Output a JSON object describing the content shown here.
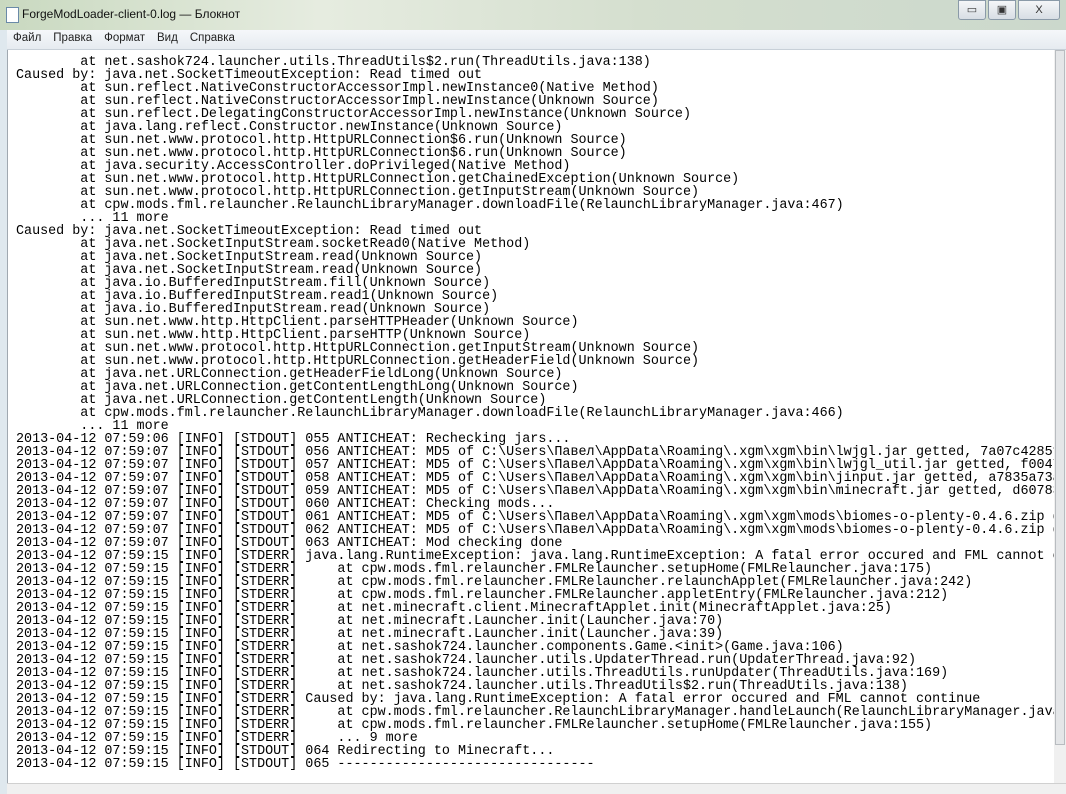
{
  "window": {
    "title": "ForgeModLoader-client-0.log — Блокнот",
    "minimize": "▭",
    "maximize": "▣",
    "close": "X"
  },
  "menu": [
    "Файл",
    "Правка",
    "Формат",
    "Вид",
    "Справка"
  ],
  "lines": [
    "        at net.sashok724.launcher.utils.ThreadUtils$2.run(ThreadUtils.java:138)",
    "Caused by: java.net.SocketTimeoutException: Read timed out",
    "        at sun.reflect.NativeConstructorAccessorImpl.newInstance0(Native Method)",
    "        at sun.reflect.NativeConstructorAccessorImpl.newInstance(Unknown Source)",
    "        at sun.reflect.DelegatingConstructorAccessorImpl.newInstance(Unknown Source)",
    "        at java.lang.reflect.Constructor.newInstance(Unknown Source)",
    "        at sun.net.www.protocol.http.HttpURLConnection$6.run(Unknown Source)",
    "        at sun.net.www.protocol.http.HttpURLConnection$6.run(Unknown Source)",
    "        at java.security.AccessController.doPrivileged(Native Method)",
    "        at sun.net.www.protocol.http.HttpURLConnection.getChainedException(Unknown Source)",
    "        at sun.net.www.protocol.http.HttpURLConnection.getInputStream(Unknown Source)",
    "        at cpw.mods.fml.relauncher.RelaunchLibraryManager.downloadFile(RelaunchLibraryManager.java:467)",
    "        ... 11 more",
    "Caused by: java.net.SocketTimeoutException: Read timed out",
    "        at java.net.SocketInputStream.socketRead0(Native Method)",
    "        at java.net.SocketInputStream.read(Unknown Source)",
    "        at java.net.SocketInputStream.read(Unknown Source)",
    "        at java.io.BufferedInputStream.fill(Unknown Source)",
    "        at java.io.BufferedInputStream.read1(Unknown Source)",
    "        at java.io.BufferedInputStream.read(Unknown Source)",
    "        at sun.net.www.http.HttpClient.parseHTTPHeader(Unknown Source)",
    "        at sun.net.www.http.HttpClient.parseHTTP(Unknown Source)",
    "        at sun.net.www.protocol.http.HttpURLConnection.getInputStream(Unknown Source)",
    "        at sun.net.www.protocol.http.HttpURLConnection.getHeaderField(Unknown Source)",
    "        at java.net.URLConnection.getHeaderFieldLong(Unknown Source)",
    "        at java.net.URLConnection.getContentLengthLong(Unknown Source)",
    "        at java.net.URLConnection.getContentLength(Unknown Source)",
    "        at cpw.mods.fml.relauncher.RelaunchLibraryManager.downloadFile(RelaunchLibraryManager.java:466)",
    "        ... 11 more",
    "2013-04-12 07:59:06 [INFO] [STDOUT] 055 ANTICHEAT: Rechecking jars...",
    "2013-04-12 07:59:07 [INFO] [STDOUT] 056 ANTICHEAT: MD5 of C:\\Users\\Павел\\AppData\\Roaming\\.xgm\\xgm\\bin\\lwjgl.jar getted, 7a07c4285f",
    "2013-04-12 07:59:07 [INFO] [STDOUT] 057 ANTICHEAT: MD5 of C:\\Users\\Павел\\AppData\\Roaming\\.xgm\\xgm\\bin\\lwjgl_util.jar getted, f0047",
    "2013-04-12 07:59:07 [INFO] [STDOUT] 058 ANTICHEAT: MD5 of C:\\Users\\Павел\\AppData\\Roaming\\.xgm\\xgm\\bin\\jinput.jar getted, a7835a73a",
    "2013-04-12 07:59:07 [INFO] [STDOUT] 059 ANTICHEAT: MD5 of C:\\Users\\Павел\\AppData\\Roaming\\.xgm\\xgm\\bin\\minecraft.jar getted, d60783",
    "2013-04-12 07:59:07 [INFO] [STDOUT] 060 ANTICHEAT: Checking mods...",
    "2013-04-12 07:59:07 [INFO] [STDOUT] 061 ANTICHEAT: MD5 of C:\\Users\\Павел\\AppData\\Roaming\\.xgm\\xgm\\mods\\biomes-o-plenty-0.4.6.zip g",
    "2013-04-12 07:59:07 [INFO] [STDOUT] 062 ANTICHEAT: MD5 of C:\\Users\\Павел\\AppData\\Roaming\\.xgm\\xgm\\mods\\biomes-o-plenty-0.4.6.zip g",
    "2013-04-12 07:59:07 [INFO] [STDOUT] 063 ANTICHEAT: Mod checking done",
    "2013-04-12 07:59:15 [INFO] [STDERR] java.lang.RuntimeException: java.lang.RuntimeException: A fatal error occured and FML cannot c",
    "2013-04-12 07:59:15 [INFO] [STDERR]     at cpw.mods.fml.relauncher.FMLRelauncher.setupHome(FMLRelauncher.java:175)",
    "2013-04-12 07:59:15 [INFO] [STDERR]     at cpw.mods.fml.relauncher.FMLRelauncher.relaunchApplet(FMLRelauncher.java:242)",
    "2013-04-12 07:59:15 [INFO] [STDERR]     at cpw.mods.fml.relauncher.FMLRelauncher.appletEntry(FMLRelauncher.java:212)",
    "2013-04-12 07:59:15 [INFO] [STDERR]     at net.minecraft.client.MinecraftApplet.init(MinecraftApplet.java:25)",
    "2013-04-12 07:59:15 [INFO] [STDERR]     at net.minecraft.Launcher.init(Launcher.java:70)",
    "2013-04-12 07:59:15 [INFO] [STDERR]     at net.minecraft.Launcher.init(Launcher.java:39)",
    "2013-04-12 07:59:15 [INFO] [STDERR]     at net.sashok724.launcher.components.Game.<init>(Game.java:106)",
    "2013-04-12 07:59:15 [INFO] [STDERR]     at net.sashok724.launcher.utils.UpdaterThread.run(UpdaterThread.java:92)",
    "2013-04-12 07:59:15 [INFO] [STDERR]     at net.sashok724.launcher.utils.ThreadUtils.runUpdater(ThreadUtils.java:169)",
    "2013-04-12 07:59:15 [INFO] [STDERR]     at net.sashok724.launcher.utils.ThreadUtils$2.run(ThreadUtils.java:138)",
    "2013-04-12 07:59:15 [INFO] [STDERR] Caused by: java.lang.RuntimeException: A fatal error occured and FML cannot continue",
    "2013-04-12 07:59:15 [INFO] [STDERR]     at cpw.mods.fml.relauncher.RelaunchLibraryManager.handleLaunch(RelaunchLibraryManager.java",
    "2013-04-12 07:59:15 [INFO] [STDERR]     at cpw.mods.fml.relauncher.FMLRelauncher.setupHome(FMLRelauncher.java:155)",
    "2013-04-12 07:59:15 [INFO] [STDERR]     ... 9 more",
    "2013-04-12 07:59:15 [INFO] [STDOUT] 064 Redirecting to Minecraft...",
    "2013-04-12 07:59:15 [INFO] [STDOUT] 065 --------------------------------"
  ]
}
